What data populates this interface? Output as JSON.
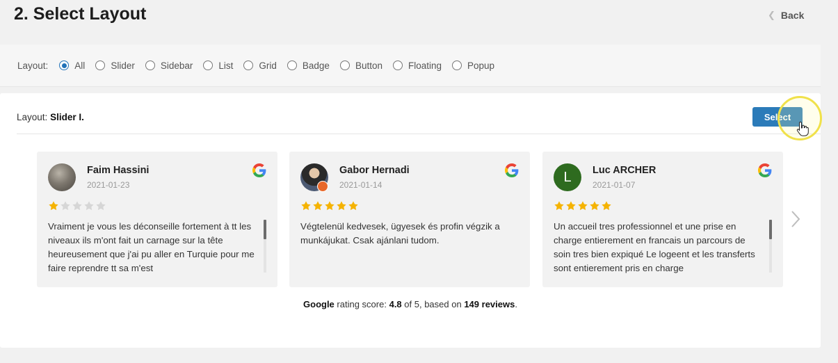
{
  "header": {
    "title": "2. Select Layout",
    "back_label": "Back"
  },
  "filter": {
    "label": "Layout:",
    "options": [
      "All",
      "Slider",
      "Sidebar",
      "List",
      "Grid",
      "Badge",
      "Button",
      "Floating",
      "Popup"
    ],
    "selected": "All"
  },
  "panel": {
    "layout_prefix": "Layout:",
    "layout_name": "Slider I.",
    "select_label": "Select"
  },
  "reviews": [
    {
      "name": "Faim Hassini",
      "date": "2021-01-23",
      "rating": 1,
      "text": "Vraiment je vous les déconseille fortement à tt les niveaux ils m'ont fait un carnage sur la tête heureusement que j'ai pu aller en Turquie pour me faire reprendre tt sa m'est",
      "has_scrollbar": true
    },
    {
      "name": "Gabor Hernadi",
      "date": "2021-01-14",
      "rating": 5,
      "text": "Végtelenül kedvesek, ügyesek és profin végzik a munkájukat. Csak ajánlani tudom.",
      "has_scrollbar": false
    },
    {
      "name": "Luc ARCHER",
      "date": "2021-01-07",
      "rating": 5,
      "avatar_letter": "L",
      "text": "Un accueil tres professionnel et une prise en charge entierement en francais un parcours de soin tres bien expiqué Le logeent et les transferts sont entierement pris en charge",
      "has_scrollbar": true
    }
  ],
  "summary": {
    "brand": "Google",
    "label": "rating score:",
    "score": "4.8",
    "of_text": "of 5, based on",
    "reviews_count": "149 reviews",
    "end": "."
  },
  "colors": {
    "accent": "#2b7bb9",
    "star": "#f5b301",
    "star_empty": "#d6d6d6",
    "radio": "#2272b8"
  },
  "icons": [
    "back-chevron-icon",
    "google-icon",
    "star-icon",
    "chevron-right-icon",
    "hand-cursor-icon"
  ]
}
